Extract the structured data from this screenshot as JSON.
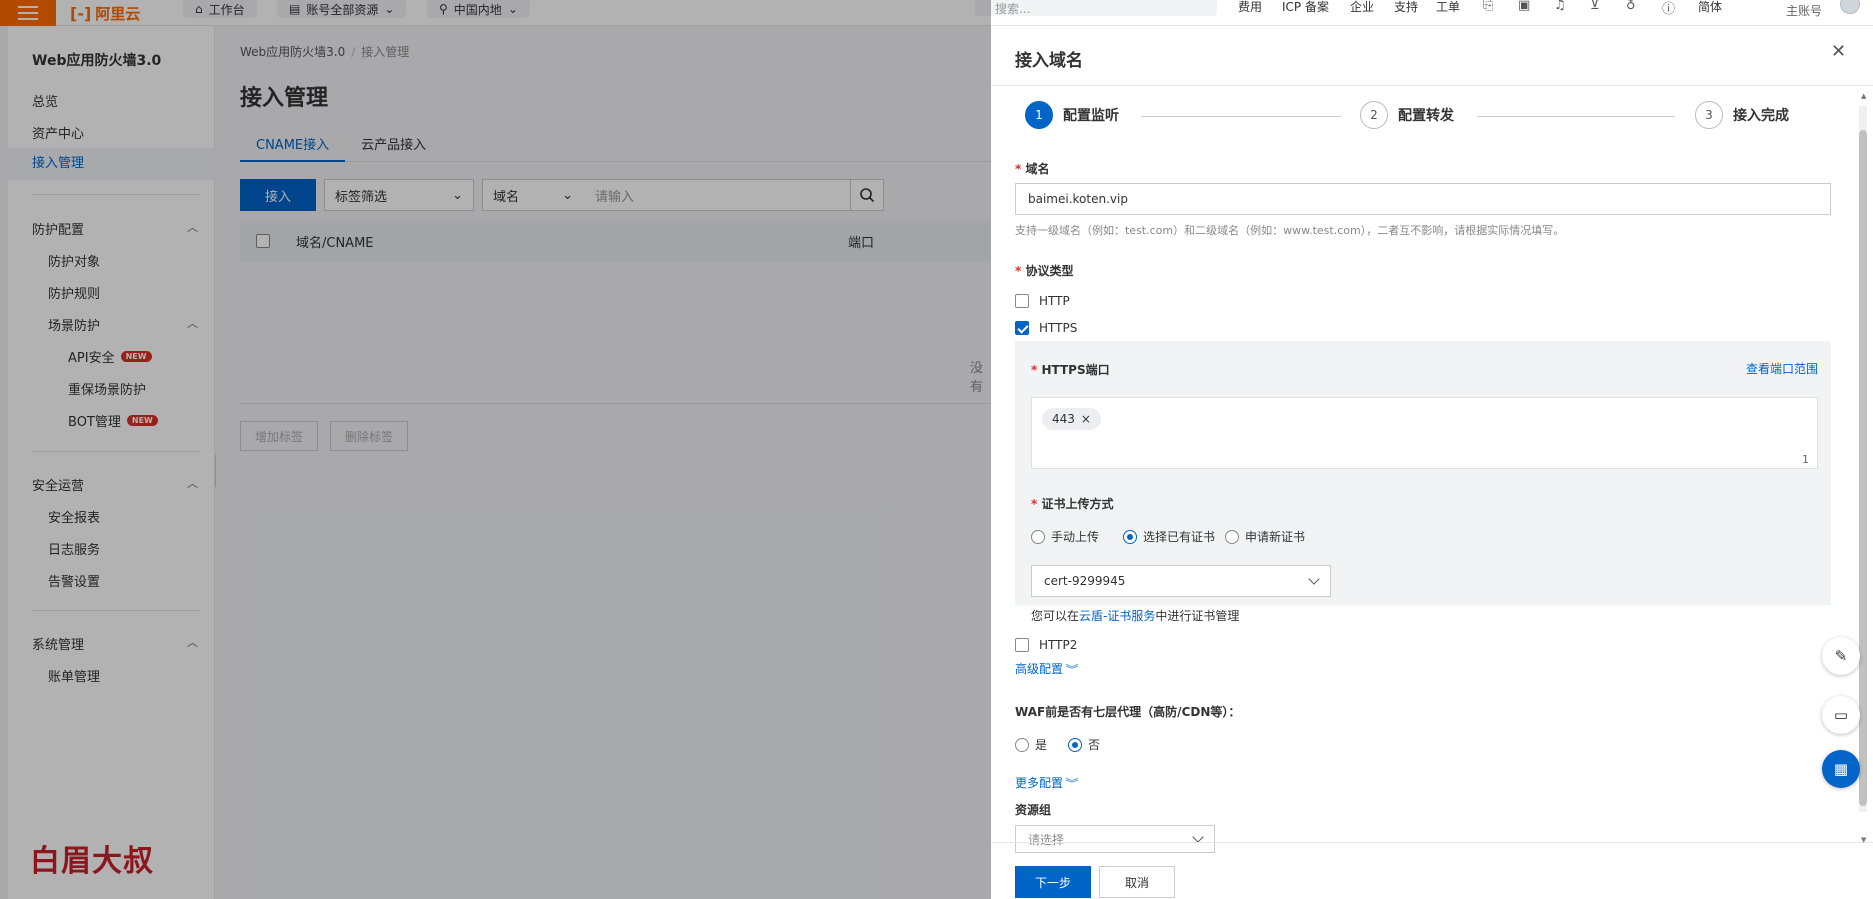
{
  "topbar": {
    "logo_text": "阿里云",
    "workbench": "工作台",
    "account_resources": "账号全部资源",
    "region": "中国内地",
    "search_placeholder": "搜索...",
    "links": [
      "费用",
      "ICP 备案",
      "企业",
      "支持",
      "工单"
    ],
    "lang": "简体",
    "account": "主账号"
  },
  "sidebar": {
    "title": "Web应用防火墙3.0",
    "top_items": [
      "总览",
      "资产中心",
      "接入管理"
    ],
    "sections": {
      "protection": {
        "label": "防护配置",
        "items": [
          "防护对象",
          "防护规则"
        ],
        "scene": {
          "label": "场景防护",
          "items": [
            {
              "label": "API安全",
              "badge": "NEW"
            },
            {
              "label": "重保场景防护",
              "badge": ""
            },
            {
              "label": "BOT管理",
              "badge": "NEW"
            }
          ]
        }
      },
      "security_ops": {
        "label": "安全运营",
        "items": [
          "安全报表",
          "日志服务",
          "告警设置"
        ]
      },
      "system": {
        "label": "系统管理",
        "items": [
          "账单管理"
        ]
      }
    },
    "watermark": "白眉大叔"
  },
  "main": {
    "breadcrumb": [
      "Web应用防火墙3.0",
      "接入管理"
    ],
    "title": "接入管理",
    "tabs": [
      "CNAME接入",
      "云产品接入"
    ],
    "access_button": "接入",
    "tag_filter": "标签筛选",
    "search_field": "域名",
    "search_placeholder": "请输入",
    "table_columns": [
      "域名/CNAME",
      "端口"
    ],
    "empty_text": "没有",
    "add_tag": "增加标签",
    "delete_tag": "删除标签"
  },
  "drawer": {
    "title": "接入域名",
    "steps": [
      {
        "num": "1",
        "label": "配置监听"
      },
      {
        "num": "2",
        "label": "配置转发"
      },
      {
        "num": "3",
        "label": "接入完成"
      }
    ],
    "domain_label": "域名",
    "domain_value": "baimei.koten.vip",
    "domain_hint": "支持一级域名（例如：test.com）和二级域名（例如：www.test.com），二者互不影响，请根据实际情况填写。",
    "protocol_label": "协议类型",
    "protocol_http": "HTTP",
    "protocol_https": "HTTPS",
    "https_port_label": "HTTPS端口",
    "view_port_range": "查看端口范围",
    "https_port_tag": "443",
    "https_port_count": "1",
    "cert_upload_label": "证书上传方式",
    "cert_options": [
      "手动上传",
      "选择已有证书",
      "申请新证书"
    ],
    "cert_selected": "cert-9299945",
    "cert_note_prefix": "您可以在",
    "cert_note_link": "云盾-证书服务",
    "cert_note_suffix": "中进行证书管理",
    "http2": "HTTP2",
    "advanced": "高级配置",
    "proxy_question": "WAF前是否有七层代理（高防/CDN等）：",
    "proxy_yes": "是",
    "proxy_no": "否",
    "more_config": "更多配置",
    "resource_group": "资源组",
    "resource_group_placeholder": "请选择",
    "next": "下一步",
    "cancel": "取消"
  },
  "colors": {
    "brand": "#ff6a00",
    "primary": "#0064c8",
    "required": "#d93026"
  }
}
